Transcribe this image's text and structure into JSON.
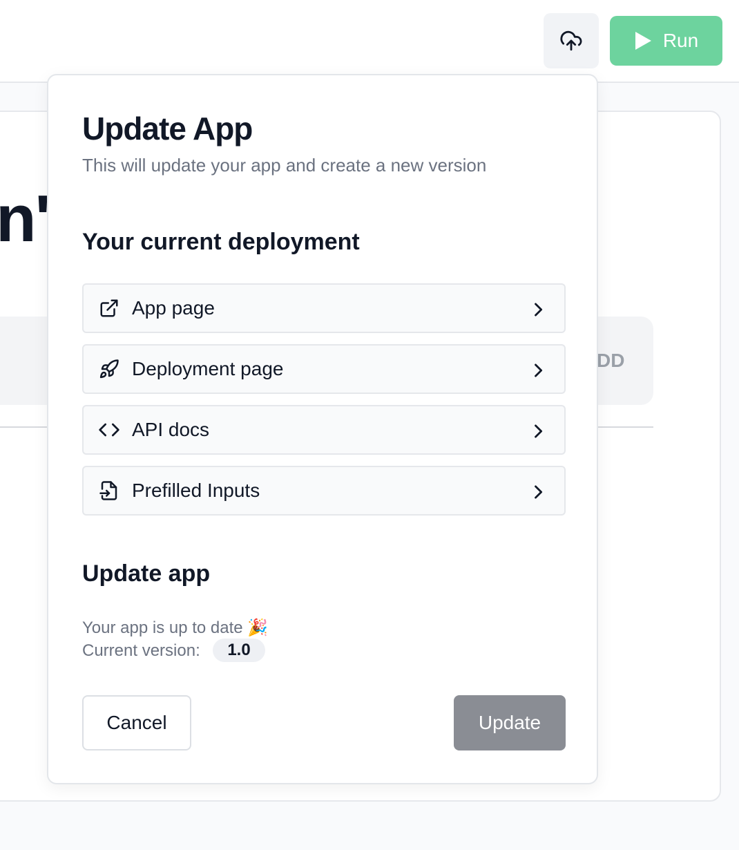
{
  "toolbar": {
    "upload_icon": "cloud-upload-icon",
    "run_label": "Run",
    "run_icon": "play-icon",
    "run_color": "#6dd39e"
  },
  "background": {
    "heading_fragment": "n'",
    "input_fragment": "DD"
  },
  "modal": {
    "title": "Update App",
    "subtitle": "This will update your app and create a new version",
    "deployment_section_title": "Your current deployment",
    "links": [
      {
        "label": "App page",
        "icon": "external-link-icon"
      },
      {
        "label": "Deployment page",
        "icon": "rocket-icon"
      },
      {
        "label": "API docs",
        "icon": "code-icon"
      },
      {
        "label": "Prefilled Inputs",
        "icon": "file-input-icon"
      }
    ],
    "update_section_title": "Update app",
    "status_text": "Your app is up to date 🎉",
    "version_label": "Current version:",
    "version_value": "1.0",
    "cancel_label": "Cancel",
    "update_label": "Update"
  }
}
